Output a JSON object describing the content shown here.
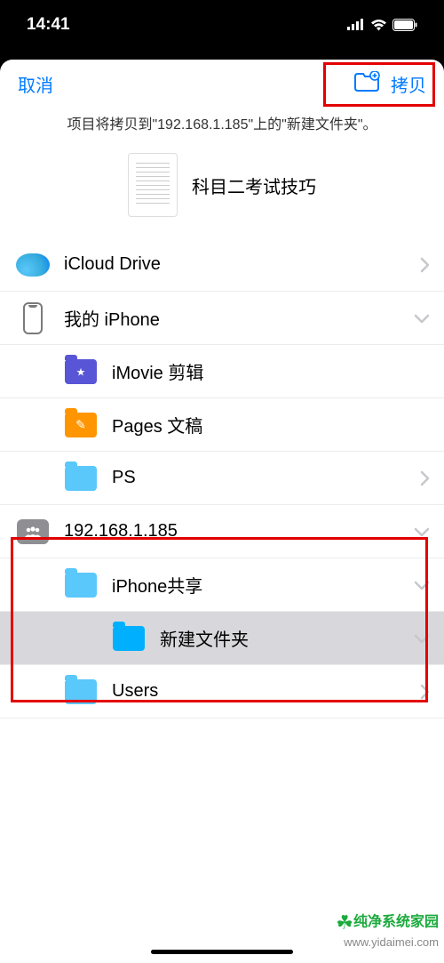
{
  "status": {
    "time": "14:41"
  },
  "nav": {
    "cancel": "取消",
    "copy": "拷贝"
  },
  "subtitle": "项目将拷贝到\"192.168.1.185\"上的\"新建文件夹\"。",
  "document": {
    "title": "科目二考试技巧"
  },
  "rows": {
    "icloud": "iCloud Drive",
    "myiphone": "我的 iPhone",
    "imovie": "iMovie 剪辑",
    "pages": "Pages 文稿",
    "ps": "PS",
    "server": "192.168.1.185",
    "iphoneshare": "iPhone共享",
    "newfolder": "新建文件夹",
    "users": "Users"
  },
  "watermark": {
    "brand": "纯净系统家园",
    "url": "www.yidaimei.com"
  }
}
